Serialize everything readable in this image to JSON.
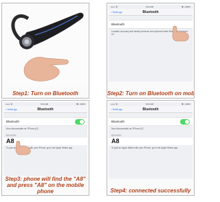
{
  "panels": [
    {
      "caption": "Step1: Turn on Bluetooth"
    },
    {
      "caption": "Step2: Turn on Bluetooth on mobile",
      "status": {
        "carrier": "•••••• 令",
        "time": "9:41 AM",
        "battery": "✱ ▪ 100%"
      },
      "back_label": "Settings",
      "title": "Bluetooth",
      "row_label": "Bluetooth",
      "note": "Location accuracy and nearby services are improved when Bluetooth is turned on."
    },
    {
      "caption": "Step3: phone will find the \"A8\" and press \"A8\" on the mobile phone",
      "status": {
        "carrier": "•••••• 令",
        "time": "9:41 AM",
        "battery": "✱ ▪ 100%"
      },
      "back_label": "Settings",
      "title": "Bluetooth",
      "row_label": "Bluetooth",
      "discoverable": "Now discoverable as \"iPhone (2)\".",
      "devices_header": "DEVICES",
      "device_name": "A8",
      "device_note": "To pair an Apple Watch with your iPhone, go to the Apple Watch app."
    },
    {
      "caption": "Step4: connected successfully",
      "status": {
        "carrier": "•••••• 令",
        "time": "9:41 AM",
        "battery": "✱ ▪ 100%"
      },
      "back_label": "Settings",
      "title": "Bluetooth",
      "row_label": "Bluetooth",
      "discoverable": "Now discoverable as \"iPhone (2)\".",
      "devices_header": "DEVICES",
      "device_name": "A8",
      "device_note": "To pair an Apple Watch with your iPhone, go to the Apple Watch app."
    }
  ]
}
